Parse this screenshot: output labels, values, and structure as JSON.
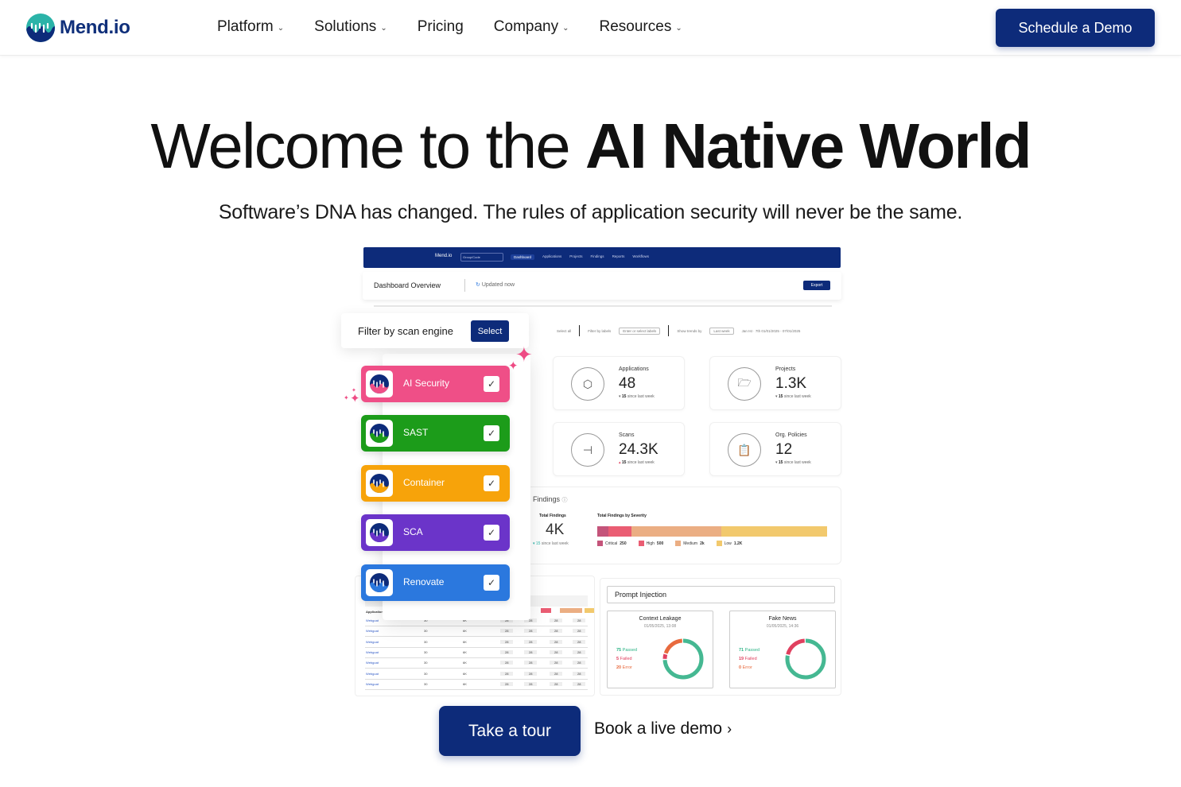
{
  "nav": {
    "logo_text": "Mend.io",
    "items": [
      {
        "label": "Platform",
        "has_dropdown": true
      },
      {
        "label": "Solutions",
        "has_dropdown": true
      },
      {
        "label": "Pricing",
        "has_dropdown": false
      },
      {
        "label": "Company",
        "has_dropdown": true
      },
      {
        "label": "Resources",
        "has_dropdown": true
      }
    ],
    "cta_label": "Schedule a Demo"
  },
  "hero": {
    "title_light": "Welcome to the ",
    "title_bold": "AI Native World",
    "subtitle": "Software’s DNA has changed. The rules of application security will never be the same."
  },
  "dashboard": {
    "topbar": {
      "logo": "Mend.io",
      "select_value": "Group/Code",
      "items": [
        {
          "label": "Dashboard",
          "active": true
        },
        {
          "label": "Applications",
          "active": false
        },
        {
          "label": "Projects",
          "active": false
        },
        {
          "label": "Findings",
          "active": false
        },
        {
          "label": "Reports",
          "active": false
        },
        {
          "label": "Workflows",
          "active": false
        }
      ]
    },
    "header": {
      "title": "Dashboard Overview",
      "updated": "Updated now",
      "export": "Export"
    },
    "filters": {
      "select_all": "Select all",
      "filter_by_labels": "Filter by labels",
      "labels_placeholder": "Enter or select labels",
      "show_trends_by": "Show trends by",
      "trend_value": "Last week",
      "date_range": "Jan Ist · 7th 01/01/2025 - 07/01/2025"
    },
    "stats": [
      {
        "label": "Applications",
        "value": "48",
        "change": "15",
        "change_text": "since last week",
        "icon": "cube-icon"
      },
      {
        "label": "Projects",
        "value": "1.3K",
        "change": "15",
        "change_text": "since last week",
        "icon": "folder-icon"
      },
      {
        "label": "Scans",
        "value": "24.3K",
        "change": "15",
        "change_text": "since last week",
        "icon": "commit-icon"
      },
      {
        "label": "Org. Policies",
        "value": "12",
        "change": "15",
        "change_text": "since last week",
        "icon": "clipboard-icon"
      }
    ],
    "findings": {
      "title": "Findings",
      "total_label": "Total Findings",
      "total_value": "4K",
      "total_change": "15",
      "total_change_text": "since last week",
      "severity_label": "Total Findings by Severity",
      "severity": [
        {
          "name": "Critical",
          "value": "250",
          "share": 0.05,
          "color": "#c4547a"
        },
        {
          "name": "High",
          "value": "500",
          "share": 0.1,
          "color": "#ea5d73"
        },
        {
          "name": "Medium",
          "value": "2k",
          "share": 0.39,
          "color": "#ebae83"
        },
        {
          "name": "Low",
          "value": "1.2K",
          "share": 0.46,
          "color": "#f2c96d"
        }
      ]
    },
    "table": {
      "header": "Application",
      "rows": [
        {
          "name": "Webgoat",
          "a": "30",
          "b": "6K",
          "c": "28",
          "d": "28",
          "e": "28",
          "f": "28"
        },
        {
          "name": "Webgoat",
          "a": "30",
          "b": "6K",
          "c": "28",
          "d": "28",
          "e": "28",
          "f": "28"
        },
        {
          "name": "Webgoat",
          "a": "30",
          "b": "6K",
          "c": "28",
          "d": "28",
          "e": "28",
          "f": "28"
        },
        {
          "name": "Webgoat",
          "a": "30",
          "b": "6K",
          "c": "28",
          "d": "28",
          "e": "28",
          "f": "28"
        },
        {
          "name": "Webgoat",
          "a": "30",
          "b": "6K",
          "c": "28",
          "d": "28",
          "e": "28",
          "f": "28"
        },
        {
          "name": "Webgoat",
          "a": "30",
          "b": "6K",
          "c": "28",
          "d": "28",
          "e": "28",
          "f": "28"
        },
        {
          "name": "Webgoat",
          "a": "30",
          "b": "6K",
          "c": "28",
          "d": "28",
          "e": "28",
          "f": "28"
        }
      ]
    },
    "prompt": {
      "title": "Prompt Injection",
      "cards": [
        {
          "title": "Context Leakage",
          "date": "01/05/2025, 13:08",
          "passed": "75",
          "failed": "5",
          "error": "20"
        },
        {
          "title": "Fake News",
          "date": "01/05/2025, 14:36",
          "passed": "71",
          "failed": "19",
          "error": "0"
        }
      ],
      "passed_label": "Passed",
      "failed_label": "Failed",
      "error_label": "Error"
    }
  },
  "filter_panel": {
    "title": "Filter by scan engine",
    "select_label": "Select",
    "engines": [
      {
        "label": "AI Security",
        "color": "#ef4f87",
        "checked": true
      },
      {
        "label": "SAST",
        "color": "#1c9c1a",
        "checked": true
      },
      {
        "label": "Container",
        "color": "#f7a30a",
        "checked": true
      },
      {
        "label": "SCA",
        "color": "#6b34c9",
        "checked": true
      },
      {
        "label": "Renovate",
        "color": "#2b78de",
        "checked": true
      }
    ]
  },
  "cta": {
    "tour_label": "Take a tour",
    "live_demo_label": "Book a live demo"
  },
  "colors": {
    "brand_navy": "#0d2b7a",
    "brand_teal": "#2bb3a8"
  }
}
